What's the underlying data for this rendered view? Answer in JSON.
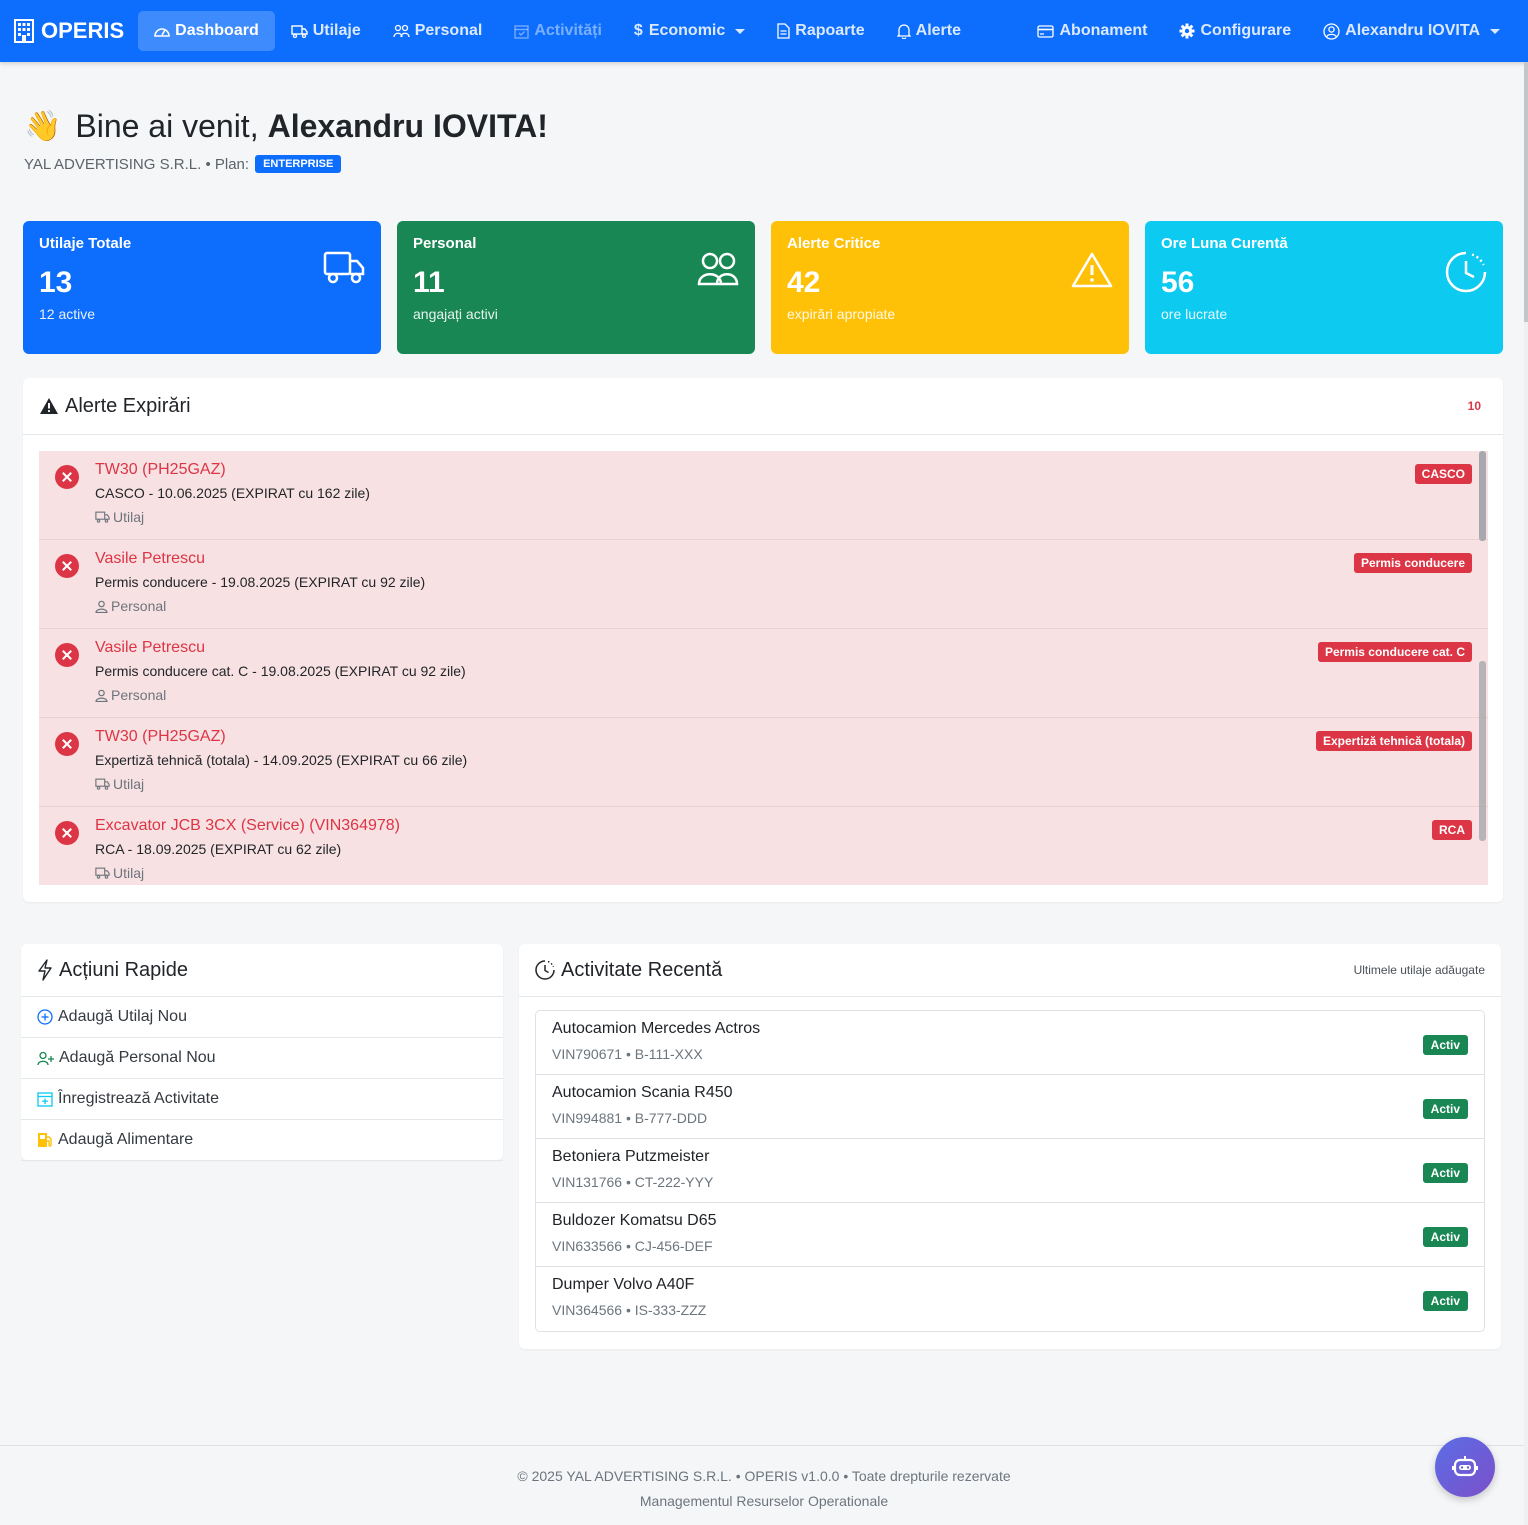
{
  "nav": {
    "brand": "OPERIS",
    "items": [
      {
        "label": "Dashboard"
      },
      {
        "label": "Utilaje"
      },
      {
        "label": "Personal"
      },
      {
        "label": "Activități"
      },
      {
        "label": "Economic"
      },
      {
        "label": "Rapoarte"
      },
      {
        "label": "Alerte"
      }
    ],
    "right": [
      {
        "label": "Abonament"
      },
      {
        "label": "Configurare"
      },
      {
        "label": "Alexandru IOVITA"
      }
    ]
  },
  "welcome": {
    "greeting": "Bine ai venit,",
    "name": "Alexandru IOVITA!",
    "company": "YAL ADVERTISING S.R.L. • Plan:",
    "plan": "ENTERPRISE"
  },
  "stats": [
    {
      "title": "Utilaje Totale",
      "value": "13",
      "sub": "12 active",
      "color": "#0d6efd",
      "icon": "truck-icon"
    },
    {
      "title": "Personal",
      "value": "11",
      "sub": "angajați activi",
      "color": "#198754",
      "icon": "people-icon"
    },
    {
      "title": "Alerte Critice",
      "value": "42",
      "sub": "expirări apropiate",
      "color": "#ffc107",
      "icon": "warning-icon"
    },
    {
      "title": "Ore Luna Curentă",
      "value": "56",
      "sub": "ore lucrate",
      "color": "#0dcaf0",
      "icon": "clock-icon"
    }
  ],
  "alerts_panel": {
    "title": "Alerte Expirări",
    "count": "10",
    "items": [
      {
        "name": "TW30 (PH25GAZ)",
        "desc": "CASCO - 10.06.2025 (EXPIRAT cu 162 zile)",
        "kind": "Utilaj",
        "tag": "CASCO"
      },
      {
        "name": "Vasile Petrescu",
        "desc": "Permis conducere - 19.08.2025 (EXPIRAT cu 92 zile)",
        "kind": "Personal",
        "tag": "Permis conducere"
      },
      {
        "name": "Vasile Petrescu",
        "desc": "Permis conducere cat. C - 19.08.2025 (EXPIRAT cu 92 zile)",
        "kind": "Personal",
        "tag": "Permis conducere cat. C"
      },
      {
        "name": "TW30 (PH25GAZ)",
        "desc": "Expertiză tehnică (totala) - 14.09.2025 (EXPIRAT cu 66 zile)",
        "kind": "Utilaj",
        "tag": "Expertiză tehnică (totala)"
      },
      {
        "name": "Excavator JCB 3CX (Service) (VIN364978)",
        "desc": "RCA - 18.09.2025 (EXPIRAT cu 62 zile)",
        "kind": "Utilaj",
        "tag": "RCA"
      }
    ]
  },
  "quick_actions": {
    "title": "Acțiuni Rapide",
    "items": [
      {
        "label": "Adaugă Utilaj Nou"
      },
      {
        "label": "Adaugă Personal Nou"
      },
      {
        "label": "Înregistrează Activitate"
      },
      {
        "label": "Adaugă Alimentare"
      }
    ]
  },
  "recent": {
    "title": "Activitate Recentă",
    "subtitle": "Ultimele utilaje adăugate",
    "items": [
      {
        "name": "Autocamion Mercedes Actros",
        "meta": "VIN790671 • B-111-XXX",
        "status": "Activ"
      },
      {
        "name": "Autocamion Scania R450",
        "meta": "VIN994881 • B-777-DDD",
        "status": "Activ"
      },
      {
        "name": "Betoniera Putzmeister",
        "meta": "VIN131766 • CT-222-YYY",
        "status": "Activ"
      },
      {
        "name": "Buldozer Komatsu D65",
        "meta": "VIN633566 • CJ-456-DEF",
        "status": "Activ"
      },
      {
        "name": "Dumper Volvo A40F",
        "meta": "VIN364566 • IS-333-ZZZ",
        "status": "Activ"
      }
    ]
  },
  "footer": {
    "line1": "© 2025 YAL ADVERTISING S.R.L. • OPERIS v1.0.0 • Toate drepturile rezervate",
    "line2": "Managementul Resurselor Operationale"
  }
}
